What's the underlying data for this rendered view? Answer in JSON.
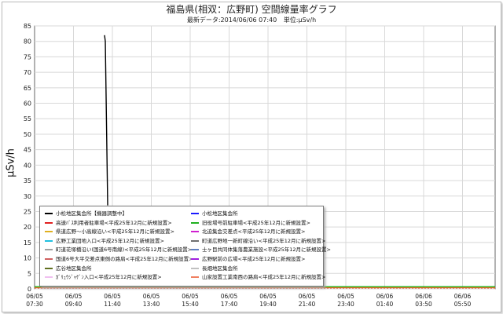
{
  "header": {
    "title": "福島県(相双：広野町) 空間線量率グラフ",
    "latest_label": "最新データ:2014/06/06 07:40",
    "unit_label": "単位:μSv/h"
  },
  "chart_data": {
    "type": "line",
    "title": "福島県(相双：広野町) 空間線量率グラフ",
    "ylabel": "μSv/h",
    "xlabel": "",
    "ylim": [
      0,
      85
    ],
    "yticks": [
      0,
      5,
      10,
      15,
      20,
      25,
      30,
      35,
      40,
      45,
      50,
      55,
      60,
      65,
      70,
      75,
      80,
      85
    ],
    "grid": true,
    "legend_placement": "bottom-left",
    "x_ticks": [
      {
        "date": "06/05",
        "time": "07:30"
      },
      {
        "date": "06/05",
        "time": "09:40"
      },
      {
        "date": "06/05",
        "time": "11:40"
      },
      {
        "date": "06/05",
        "time": "13:40"
      },
      {
        "date": "06/05",
        "time": "15:40"
      },
      {
        "date": "06/05",
        "time": "17:40"
      },
      {
        "date": "06/05",
        "time": "19:40"
      },
      {
        "date": "06/05",
        "time": "21:40"
      },
      {
        "date": "06/05",
        "time": "23:40"
      },
      {
        "date": "06/06",
        "time": "01:40"
      },
      {
        "date": "06/06",
        "time": "03:50"
      },
      {
        "date": "06/06",
        "time": "05:50"
      }
    ],
    "spike": {
      "series": "小松地区集会所【機器調整中】",
      "peak_time": "06/05 11:30",
      "peak_value": 82,
      "low_value": 27
    },
    "series": [
      {
        "name": "小松地区集会所【機器調整中】",
        "color": "#000000"
      },
      {
        "name": "小松地区集会所",
        "color": "#1a1aff"
      },
      {
        "name": "高速ﾊﾞｽ利用者駐車場<平成25年12月に新規設置>",
        "color": "#e02020"
      },
      {
        "name": "旧役場号前駐車場<平成25年12月に新規設置>",
        "color": "#20b020"
      },
      {
        "name": "県道広野～小高線沿い<平成25年12月に新規設置>",
        "color": "#e0b020"
      },
      {
        "name": "北迫集会交差点<平成25年12月に新規設置>",
        "color": "#d020d0"
      },
      {
        "name": "広野工業団地入口<平成25年12月に新規設置>",
        "color": "#20c0e0"
      },
      {
        "name": "町道広野地一新町線沿い<平成25年12月に新規設置>",
        "color": "#707070"
      },
      {
        "name": "町道花塚橋沿い(国道6号南線)<平成25年12月に新規設置>",
        "color": "#a0a0a0"
      },
      {
        "name": "士ヶ目共同体集落農業施設<平成25年12月に新規設置>",
        "color": "#6080c0"
      },
      {
        "name": "国道6号大平交差点東側の路肩<平成25年12月に新規設置>",
        "color": "#d06060"
      },
      {
        "name": "広野駅前の広場<平成25年12月に新規設置>",
        "color": "#a020e0"
      },
      {
        "name": "広谷地区集会所",
        "color": "#607020"
      },
      {
        "name": "長畑地区集会所",
        "color": "#c0c0c0"
      },
      {
        "name": "ｶﾞﾘｭｳｼﾞｬｹﾞﾝ入口<平成25年12月に新規設置>",
        "color": "#f0c0f0"
      },
      {
        "name": "山家設置工業南西の路肩<平成25年12月に新規設置>",
        "color": "#f08060"
      }
    ]
  }
}
